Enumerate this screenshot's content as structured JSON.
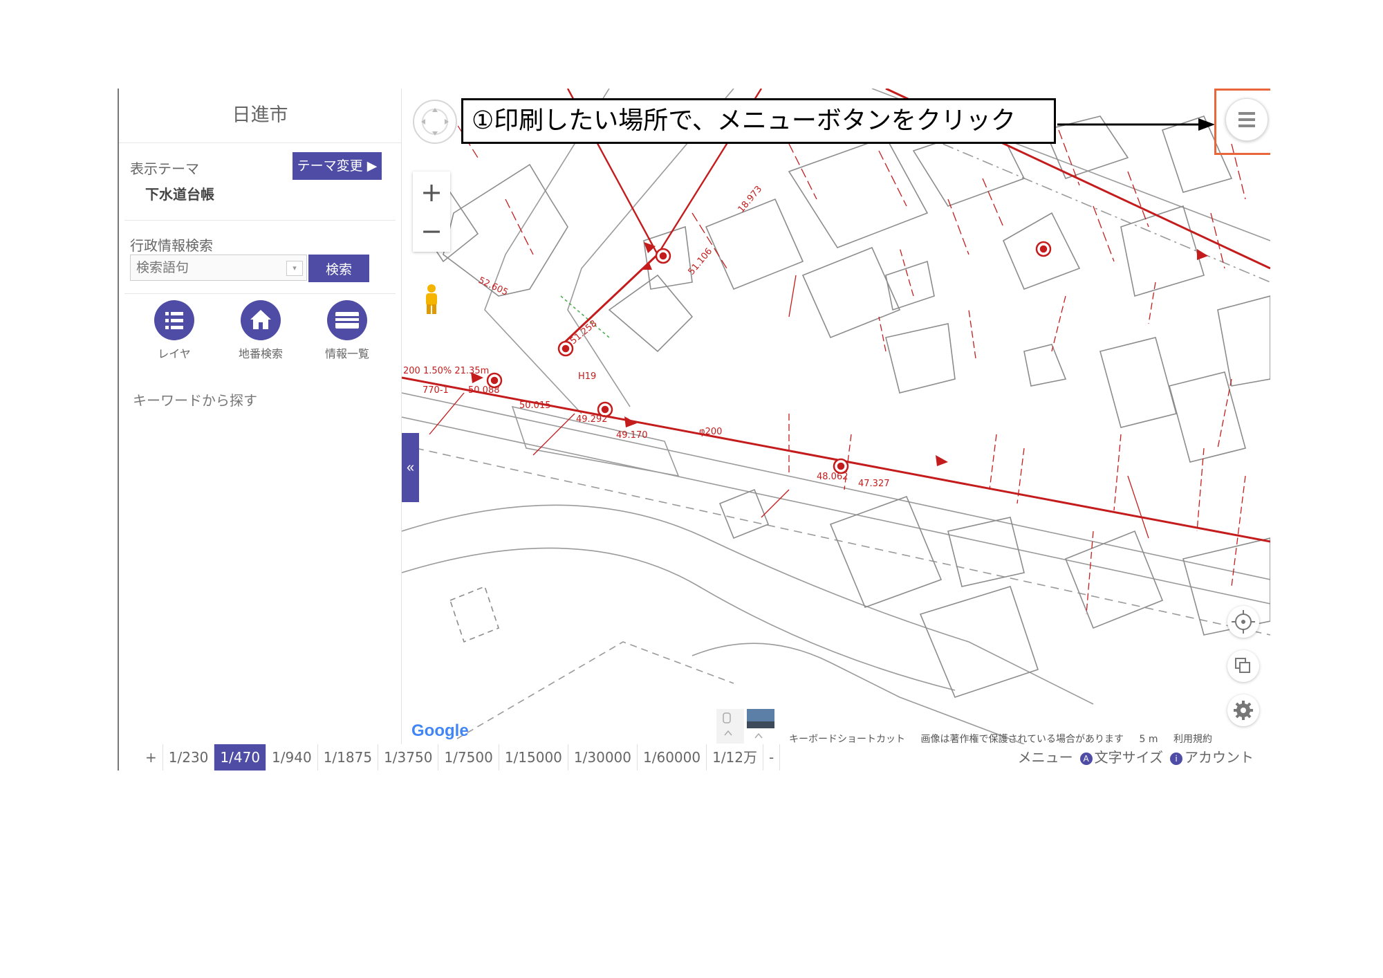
{
  "sidebar": {
    "city_name": "日進市",
    "theme_label": "表示テーマ",
    "theme_change_button": "テーマ変更 ▶",
    "theme_value": "下水道台帳",
    "search_label": "行政情報検索",
    "search_placeholder": "検索語句",
    "search_button": "検索",
    "tools": [
      {
        "label": "レイヤ",
        "icon": "list-icon"
      },
      {
        "label": "地番検索",
        "icon": "house-icon"
      },
      {
        "label": "情報一覧",
        "icon": "table-icon"
      }
    ],
    "keyword_label": "キーワードから探す"
  },
  "map": {
    "callout_text": "①印刷したい場所で、メニューボタンをクリック",
    "collapse_label": "«",
    "google_logo": "Google",
    "attribution": {
      "keyboard": "キーボードショートカット",
      "copyright": "画像は著作権で保護されている場合があります",
      "scale": "5 m",
      "terms": "利用規約"
    },
    "accent_color": "#4e4ca5",
    "sewer_color": "#c41c1c",
    "highlight_color": "#e8663a",
    "icons": [
      "navigation-icon",
      "zoom-in-icon",
      "zoom-out-icon",
      "pegman-icon",
      "menu-icon",
      "locate-icon",
      "layers-icon",
      "settings-icon"
    ],
    "annotations": [
      "200 1.50% 21.35m",
      "770-1",
      "50.088",
      "50.015",
      "49.292",
      "49.170",
      "48.062",
      "H19",
      "φ200",
      "52.605",
      "51.258",
      "51.106",
      "18.973",
      "47.327"
    ]
  },
  "bottombar": {
    "scale_plus": "+",
    "scales": [
      "1/230",
      "1/470",
      "1/940",
      "1/1875",
      "1/3750",
      "1/7500",
      "1/15000",
      "1/30000",
      "1/60000",
      "1/12万"
    ],
    "active_scale": "1/470",
    "scale_minus": "-",
    "menu_label": "メニュー",
    "font_size_label": "文字サイズ",
    "account_label": "アカウント"
  }
}
